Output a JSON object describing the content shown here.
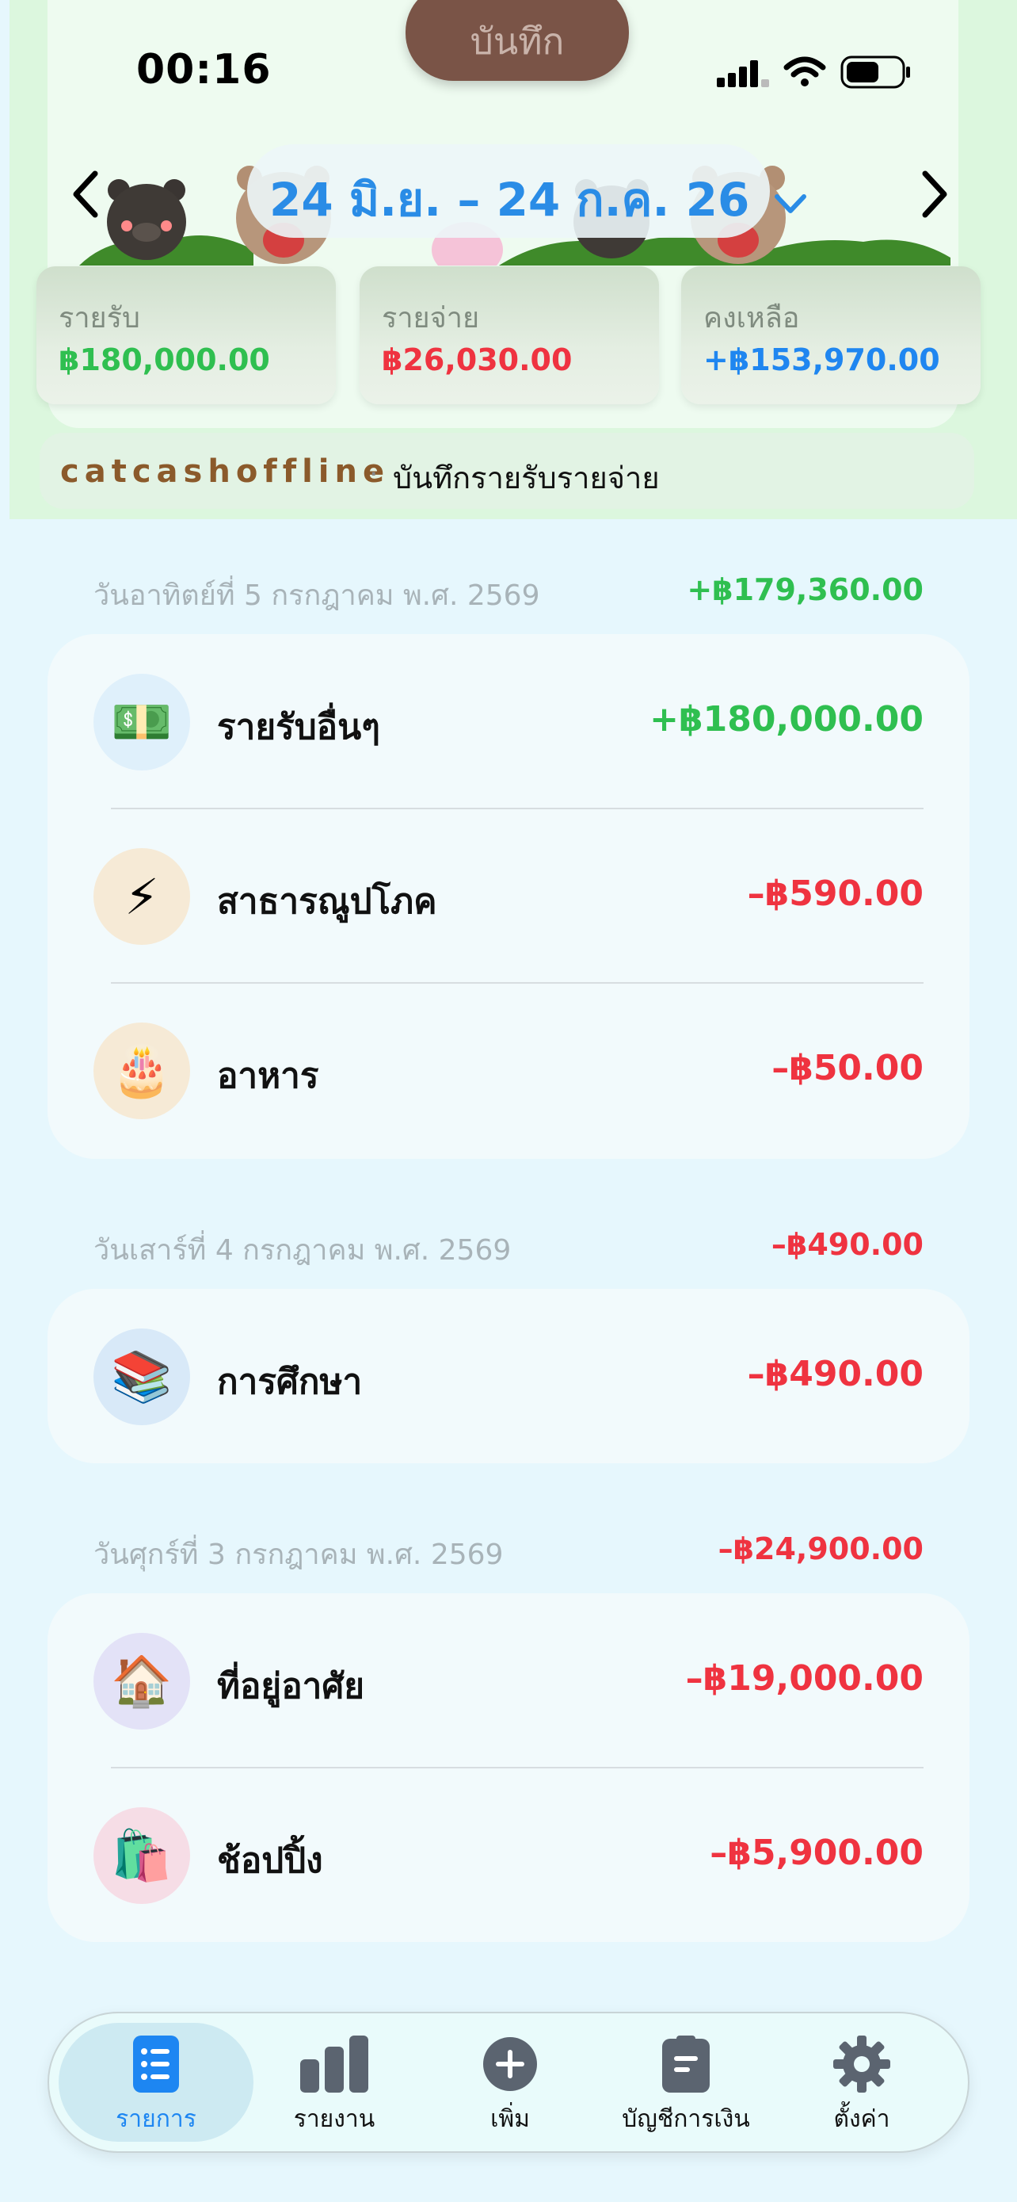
{
  "header": {
    "save_label": "บันทึก",
    "time": "00:16",
    "date_range": "24 มิ.ย. – 24 ก.ค. 26",
    "prev_icon": "chevron-left-icon",
    "next_icon": "chevron-right-icon"
  },
  "summary": {
    "income": {
      "label": "รายรับ",
      "value": "฿180,000.00"
    },
    "expense": {
      "label": "รายจ่าย",
      "value": "฿26,030.00"
    },
    "balance": {
      "label": "คงเหลือ",
      "value": "+฿153,970.00"
    }
  },
  "brand": {
    "name": "catcashoffline",
    "separator": "·",
    "subtitle": "บันทึกรายรับรายจ่าย"
  },
  "days": [
    {
      "date": "วันอาทิตย์ที่ 5 กรกฎาคม พ.ศ. 2569",
      "total": "+฿179,360.00",
      "items": [
        {
          "icon": "💵",
          "name": "รายรับอื่นๆ",
          "amount": "+฿180,000.00"
        },
        {
          "icon": "⚡",
          "name": "สาธารณูปโภค",
          "amount": "–฿590.00"
        },
        {
          "icon": "🎂",
          "name": "อาหาร",
          "amount": "–฿50.00"
        }
      ]
    },
    {
      "date": "วันเสาร์ที่ 4 กรกฎาคม พ.ศ. 2569",
      "total": "–฿490.00",
      "items": [
        {
          "icon": "📚",
          "name": "การศึกษา",
          "amount": "–฿490.00"
        }
      ]
    },
    {
      "date": "วันศุกร์ที่ 3 กรกฎาคม พ.ศ. 2569",
      "total": "–฿24,900.00",
      "items": [
        {
          "icon": "🏠",
          "name": "ที่อยู่อาศัย",
          "amount": "–฿19,000.00"
        },
        {
          "icon": "🛍️",
          "name": "ช้อปปิ้ง",
          "amount": "–฿5,900.00"
        }
      ]
    }
  ],
  "tabs": [
    {
      "label": "รายการ",
      "icon": "list-icon",
      "active": true
    },
    {
      "label": "รายงาน",
      "icon": "bar-chart-icon",
      "active": false
    },
    {
      "label": "เพิ่ม",
      "icon": "plus-circle-icon",
      "active": false
    },
    {
      "label": "บัญชีการเงิน",
      "icon": "clipboard-icon",
      "active": false
    },
    {
      "label": "ตั้งค่า",
      "icon": "gear-icon",
      "active": false
    }
  ],
  "colors": {
    "income": "#2fbf50",
    "expense": "#ef3340",
    "accent": "#1f86f0"
  }
}
